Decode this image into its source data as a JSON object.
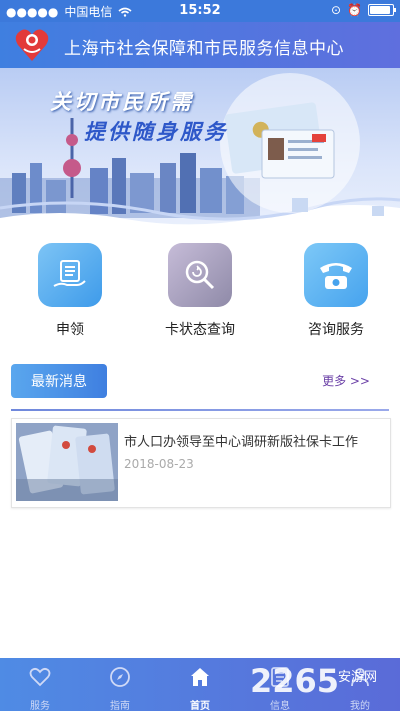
{
  "status_bar": {
    "carrier": "中国电信",
    "time": "15:52",
    "battery_level": 1.0
  },
  "header": {
    "title": "上海市社会保障和市民服务信息中心"
  },
  "banner": {
    "slogan_line1": "关切市民所需",
    "slogan_line2": "提供随身服务"
  },
  "menu": [
    {
      "label": "申领",
      "icon": "document-hand-icon"
    },
    {
      "label": "卡状态查询",
      "icon": "search-refresh-icon"
    },
    {
      "label": "咨询服务",
      "icon": "telephone-icon"
    }
  ],
  "news": {
    "section_label": "最新消息",
    "more_label": "更多 >>",
    "items": [
      {
        "title": "市人口办领导至中心调研新版社保卡工作",
        "date": "2018-08-23"
      }
    ]
  },
  "tabbar": {
    "items": [
      {
        "label": "服务",
        "icon": "heart-icon"
      },
      {
        "label": "指南",
        "icon": "compass-icon"
      },
      {
        "label": "首页",
        "icon": "home-icon"
      },
      {
        "label": "信息",
        "icon": "info-list-icon"
      },
      {
        "label": "我的",
        "icon": "user-icon"
      }
    ],
    "active": "首页"
  },
  "watermark": {
    "text": "2265",
    "site": "安游网"
  },
  "colors": {
    "header": "#3f7fe0",
    "accent": "#5aa7ee",
    "tab_inactive": "#cfd9f6"
  }
}
